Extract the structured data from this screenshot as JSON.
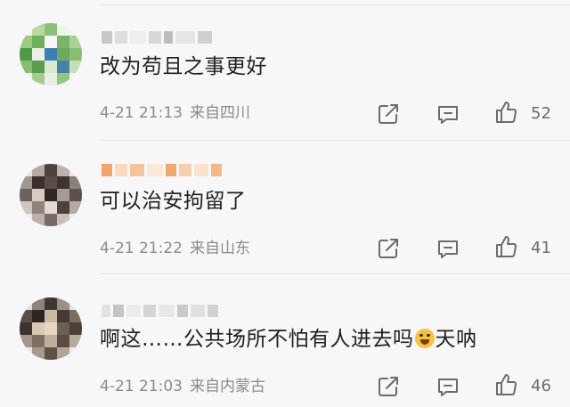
{
  "comments": [
    {
      "text": "改为苟且之事更好",
      "time": "4-21 21:13",
      "location": "来自四川",
      "likes": "52"
    },
    {
      "text": "可以治安拘留了",
      "time": "4-21 21:22",
      "location": "来自山东",
      "likes": "41"
    },
    {
      "text_before": "啊这……公共场所不怕有人进去吗",
      "emoji": "crying-laughing-emoji",
      "text_after": "天呐",
      "time": "4-21 21:03",
      "location": "来自内蒙古",
      "likes": "46"
    }
  ],
  "icons": {
    "share": "share-icon",
    "comment": "comment-icon",
    "like": "thumbs-up-icon"
  },
  "colors": {
    "background": "#f7f7f9",
    "text": "#1f1f1f",
    "meta": "#8a8a8f",
    "icon": "#6b6b70"
  }
}
